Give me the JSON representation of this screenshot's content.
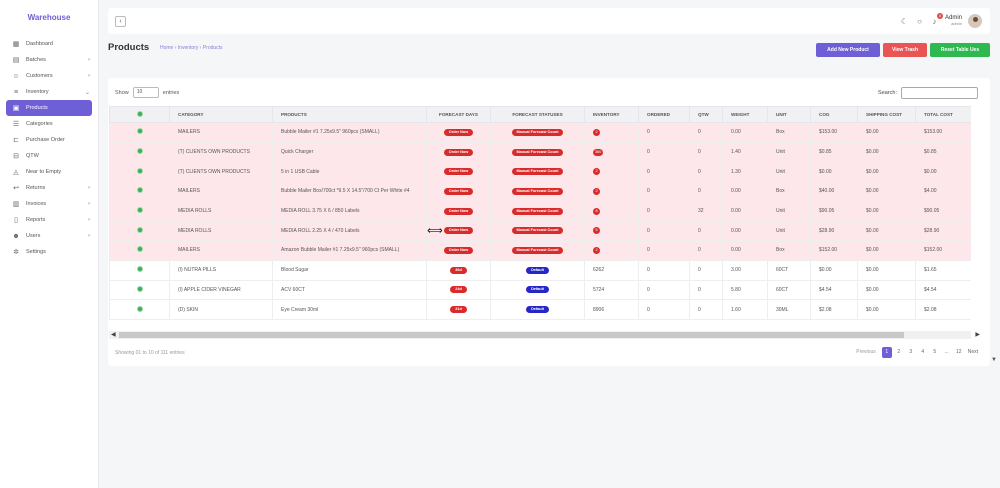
{
  "brand": "Warehouse",
  "sidebar": {
    "items": [
      {
        "label": "Dashboard",
        "icon": "grid-icon",
        "glyph": "▦",
        "chevron": false
      },
      {
        "label": "Batches",
        "icon": "book-icon",
        "glyph": "▤",
        "chevron": true
      },
      {
        "label": "Customers",
        "icon": "users-icon",
        "glyph": "☺",
        "chevron": true
      },
      {
        "label": "Inventory",
        "icon": "database-icon",
        "glyph": "≡",
        "chevron": true,
        "open": true
      },
      {
        "label": "Products",
        "icon": "box-icon",
        "glyph": "▣",
        "active": true,
        "sub": true
      },
      {
        "label": "Categories",
        "icon": "list-icon",
        "glyph": "☰",
        "sub": true
      },
      {
        "label": "Purchase Order",
        "icon": "cart-icon",
        "glyph": "⊏",
        "sub": true
      },
      {
        "label": "QTW",
        "icon": "truck-icon",
        "glyph": "⊟",
        "sub": true
      },
      {
        "label": "Near to Empty",
        "icon": "flask-icon",
        "glyph": "◬",
        "sub": true
      },
      {
        "label": "Returns",
        "icon": "return-icon",
        "glyph": "↩",
        "chevron": true
      },
      {
        "label": "Invoices",
        "icon": "invoice-icon",
        "glyph": "▥",
        "chevron": true
      },
      {
        "label": "Reports",
        "icon": "file-icon",
        "glyph": "▯",
        "chevron": true
      },
      {
        "label": "Users",
        "icon": "user-group-icon",
        "glyph": "☻",
        "chevron": true
      },
      {
        "label": "Settings",
        "icon": "gear-icon",
        "glyph": "✲",
        "chevron": false
      }
    ]
  },
  "topbar": {
    "notification_count": "4",
    "user_name": "Admin",
    "user_role": "admin"
  },
  "page": {
    "title": "Products",
    "breadcrumb": [
      "Home",
      "Inventory",
      "Products"
    ]
  },
  "buttons": {
    "add": "Add New Product",
    "trash": "View Trash",
    "reset": "Reset Table Ues"
  },
  "table": {
    "show_label": "Show",
    "show_value": "10",
    "entries_label": "entries",
    "search_label": "Search:",
    "columns": [
      "",
      "CATEGORY",
      "PRODUCTS",
      "FORECAST DAYS",
      "FORECAST STATUSES",
      "INVENTORY",
      "ORDERED",
      "QTW",
      "WEIGHT",
      "UNIT",
      "COG",
      "SHIPPING COST",
      "TOTAL COST"
    ],
    "rows": [
      {
        "red": true,
        "category": "MAILERS",
        "product": "Bubble Mailer #1 7.25x9.5\" 960pcs (SMALL)",
        "forecast": "Order Now",
        "status": "Manual Forecast Count",
        "inventory": "2",
        "ordered": "0",
        "qtw": "0",
        "weight": "0.00",
        "unit": "Box",
        "cog": "$153.00",
        "shipping": "$0.00",
        "total": "$153.00"
      },
      {
        "red": true,
        "category": "(T) CLIENTS OWN PRODUCTS",
        "product": "Quick Charger",
        "forecast": "Order Now",
        "status": "Manual Forecast Count",
        "inventory": "360",
        "ordered": "0",
        "qtw": "0",
        "weight": "1.40",
        "unit": "Unit",
        "cog": "$0.85",
        "shipping": "$0.00",
        "total": "$0.85"
      },
      {
        "red": true,
        "category": "(T) CLIENTS OWN PRODUCTS",
        "product": "5 in 1 USB Cable",
        "forecast": "Order Now",
        "status": "Manual Forecast Count",
        "inventory": "2",
        "ordered": "0",
        "qtw": "0",
        "weight": "1.30",
        "unit": "Unit",
        "cog": "$0.00",
        "shipping": "$0.00",
        "total": "$0.00"
      },
      {
        "red": true,
        "category": "MAILERS",
        "product": "Bubble Mailer Box/700ct *9.5 X 14.5\"/700 Ct Per White #4",
        "forecast": "Order Now",
        "status": "Manual Forecast Count",
        "inventory": "2",
        "ordered": "0",
        "qtw": "0",
        "weight": "0.00",
        "unit": "Box",
        "cog": "$40.00",
        "shipping": "$0.00",
        "total": "$4.00"
      },
      {
        "red": true,
        "category": "MEDIA ROLLS",
        "product": "MEDIA ROLL 3.75 X 6 / 850 Labels",
        "forecast": "Order Now",
        "status": "Manual Forecast Count",
        "inventory": "8",
        "ordered": "0",
        "qtw": "32",
        "weight": "0.00",
        "unit": "Unit",
        "cog": "$90.05",
        "shipping": "$0.00",
        "total": "$90.05"
      },
      {
        "red": true,
        "category": "MEDIA ROLLS",
        "product": "MEDIA ROLL 2.25 X 4 / 470 Labels",
        "forecast": "Order Now",
        "status": "Manual Forecast Count",
        "inventory": "5",
        "ordered": "0",
        "qtw": "0",
        "weight": "0.00",
        "unit": "Unit",
        "cog": "$28.90",
        "shipping": "$0.00",
        "total": "$28.90"
      },
      {
        "red": true,
        "category": "MAILERS",
        "product": "Amazon Bubble Mailer #1 7.25x9.5\" 960pcs (SMALL)",
        "forecast": "Order Now",
        "status": "Manual Forecast Count",
        "inventory": "2",
        "ordered": "0",
        "qtw": "0",
        "weight": "0.00",
        "unit": "Box",
        "cog": "$152.00",
        "shipping": "$0.00",
        "total": "$152.00"
      },
      {
        "red": false,
        "category": "(I) NUTRA PILLS",
        "product": "Blood Sugar",
        "forecast": "36d",
        "status": "Default",
        "inventory": "6262",
        "ordered": "0",
        "qtw": "0",
        "weight": "3.00",
        "unit": "60CT",
        "cog": "$0.00",
        "shipping": "$0.00",
        "total": "$1.65"
      },
      {
        "red": false,
        "category": "(I) APPLE CIDER VINEGAR",
        "product": "ACV 60CT",
        "forecast": "24d",
        "status": "Default",
        "inventory": "5724",
        "ordered": "0",
        "qtw": "0",
        "weight": "5.80",
        "unit": "60CT",
        "cog": "$4.54",
        "shipping": "$0.00",
        "total": "$4.54"
      },
      {
        "red": false,
        "category": "(D) SKIN",
        "product": "Eye Cream 30ml",
        "forecast": "31d",
        "status": "Default",
        "inventory": "8906",
        "ordered": "0",
        "qtw": "0",
        "weight": "1.60",
        "unit": "30ML",
        "cog": "$2.08",
        "shipping": "$0.00",
        "total": "$2.08"
      }
    ],
    "showing": "Showing 01 to 10 of 111 entries",
    "pagination": {
      "previous": "Previous",
      "pages": [
        "1",
        "2",
        "3",
        "4",
        "5",
        "...",
        "12"
      ],
      "next": "Next"
    }
  },
  "colors": {
    "accent": "#6f5fd6",
    "danger": "#e95454",
    "success": "#2fb84f",
    "row_red": "#fde7ea"
  }
}
